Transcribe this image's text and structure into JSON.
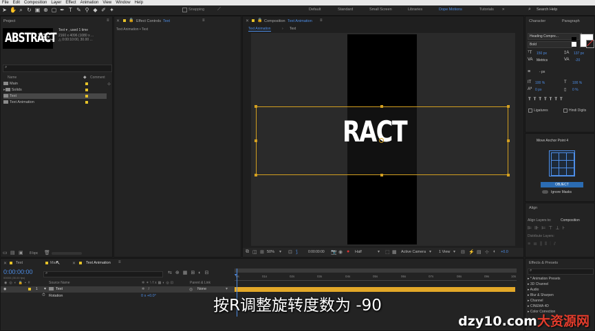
{
  "menu": [
    "File",
    "Edit",
    "Composition",
    "Layer",
    "Effect",
    "Animation",
    "View",
    "Window",
    "Help"
  ],
  "toolbar": {
    "snapping": "Snapping",
    "workspaces": [
      "Default",
      "Standard",
      "Small Screen",
      "Libraries",
      "Dope Motions",
      "Tutorials"
    ],
    "active_workspace": "Dope Motions",
    "search_placeholder": "Search Help"
  },
  "project": {
    "tab": "Project",
    "thumb_title": "ABSTRACT",
    "thumb_sub": "THE ART OF ULTIMATE TYPOGRAPHY",
    "info_name": "Text ▾ , used 1 time",
    "info_size": "2160 x 4096 (1080 x ...",
    "info_time": "△ 0:00:10:00, 30.00 ...",
    "col_name": "Name",
    "col_comment": "Comment",
    "items": [
      "Main",
      "Solids",
      "Text",
      "Text Animation"
    ],
    "bpc": "8 bpc"
  },
  "effect_controls": {
    "tab_prefix": "Effect Controls",
    "tab_layer": "Text",
    "subtitle": "Text Animation • Text"
  },
  "composition": {
    "tab_prefix": "Composition",
    "tab_name": "Text Animation",
    "subtab_active": "Text Animation",
    "subtab_other": "Text",
    "canvas_text": "RACT",
    "zoom": "50%",
    "timecode": "0:00:00:00",
    "resolution": "Half",
    "camera": "Active Camera",
    "view": "1 View",
    "exposure": "+0.0"
  },
  "character": {
    "tab": "Character",
    "tab2": "Paragraph",
    "font": "Heading Compre...",
    "style": "Bold",
    "size": "150 px",
    "leading": "137 px",
    "kerning": "Metrics",
    "tracking": "-20",
    "stroke": "- px",
    "vscale": "100 %",
    "hscale": "100 %",
    "baseline": "0 px",
    "tsume": "0 %",
    "ligatures": "Ligatures",
    "hindi": "Hindi Digits"
  },
  "anchor": {
    "title": "Move Anchor Point 4",
    "object": "OBJECT",
    "ignore_masks": "Ignore Masks"
  },
  "align": {
    "tab": "Align",
    "layers_to": "Align Layers to:",
    "target": "Composition",
    "distribute": "Distribute Layers:"
  },
  "effects": {
    "tab": "Effects & Presets",
    "items": [
      "* Animation Presets",
      "3D Channel",
      "Audio",
      "Blur & Sharpen",
      "Channel",
      "CINEMA 4D",
      "Color Correction"
    ]
  },
  "timeline": {
    "tabs": [
      "Text",
      "Main",
      "Text Animation"
    ],
    "timecode": "0:00:00:00",
    "frames": "00000 (30.00 fps)",
    "col_source": "Source Name",
    "col_parent": "Parent & Link",
    "layer_num": "1",
    "layer_name": "Text",
    "parent": "None",
    "property": "Rotation",
    "rotation_value": "0 x +0.0°",
    "ruler": [
      "0s",
      "01s",
      "02s",
      "03s",
      "04s",
      "05s",
      "06s",
      "07s",
      "08s",
      "09s",
      "10s"
    ]
  },
  "subtitle": "按R调整旋转度数为 -90",
  "watermark": {
    "domain": "dzy10.com",
    "brand": "大资源网"
  }
}
